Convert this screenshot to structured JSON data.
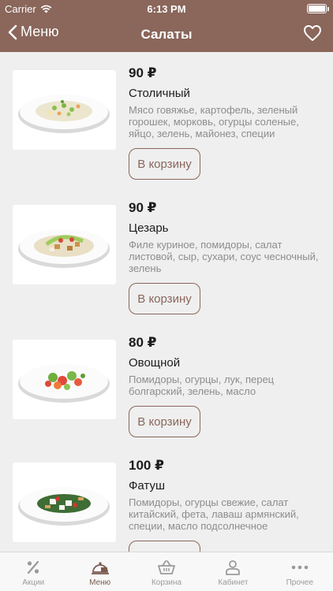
{
  "status_bar": {
    "carrier": "Carrier",
    "time": "6:13 PM"
  },
  "nav": {
    "back_label": "Меню",
    "title": "Салаты"
  },
  "products": [
    {
      "price": "90 ₽",
      "name": "Столичный",
      "description": "Мясо говяжье, картофель, зеленый горошек, морковь, огурцы соленые, яйцо, зелень, майонез, специи",
      "button": "В корзину"
    },
    {
      "price": "90 ₽",
      "name": "Цезарь",
      "description": "Филе куриное, помидоры, салат листовой, сыр, сухари, соус чесночный, зелень",
      "button": "В корзину"
    },
    {
      "price": "80 ₽",
      "name": "Овощной",
      "description": "Помидоры, огурцы, лук, перец болгарский, зелень, масло",
      "button": "В корзину"
    },
    {
      "price": "100 ₽",
      "name": "Фатуш",
      "description": "Помидоры, огурцы свежие, салат китайский, фета, лаваш армянский, специи, масло подсолнечное",
      "button": "В корзину"
    }
  ],
  "tabs": [
    {
      "label": "Акции",
      "icon": "percent-icon"
    },
    {
      "label": "Меню",
      "icon": "cloche-icon",
      "active": true
    },
    {
      "label": "Корзина",
      "icon": "basket-icon"
    },
    {
      "label": "Кабинет",
      "icon": "person-icon"
    },
    {
      "label": "Прочее",
      "icon": "more-dots-icon"
    }
  ],
  "colors": {
    "brand": "#8a665b",
    "background": "#efefef",
    "inactive_tab": "#9a9a9a"
  }
}
